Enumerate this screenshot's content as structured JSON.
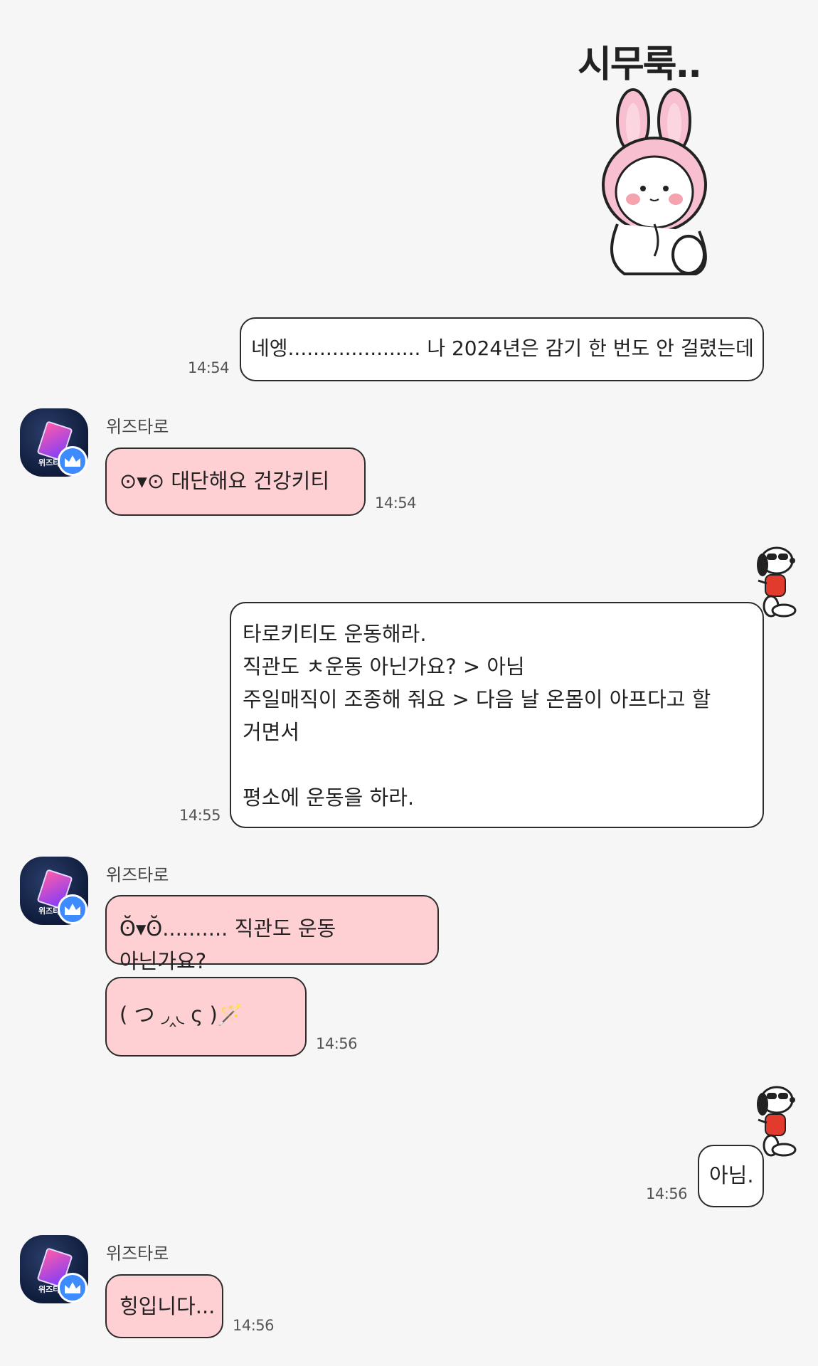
{
  "sticker": {
    "caption": "시무룩.."
  },
  "messages": [
    {
      "sender": "me",
      "text": "네엥..................... 나 2024년은 감기 한 번도 안 걸렸는데",
      "time": "14:54"
    },
    {
      "sender": "위즈타로",
      "text": "⊙▾⊙ 대단해요 건강키티",
      "time": "14:54"
    },
    {
      "sender": "me",
      "text": "타로키티도 운동해라.\n직관도 ㅊ운동 아닌가요? > 아님\n주일매직이 조종해 줘요 > 다음 날 온몸이 아프다고 할 거면서\n\n평소에 운동을 하라.",
      "time": "14:55"
    },
    {
      "sender": "위즈타로",
      "text": "ʘ̆▾ʘ̆.......... 직관도 운동 아닌가요?",
      "time": ""
    },
    {
      "sender": "위즈타로",
      "text": "( つ ◞‸◟ ς )🪄",
      "time": "14:56"
    },
    {
      "sender": "me",
      "text": "아님.",
      "time": "14:56"
    },
    {
      "sender": "위즈타로",
      "text": "힝입니다...",
      "time": "14:56"
    }
  ],
  "avatar_label": "위즈타로",
  "colors": {
    "background": "#f6f6f7",
    "my_bubble": "#ffffff",
    "their_bubble": "#ffd0d3",
    "badge": "#3d8bff"
  }
}
